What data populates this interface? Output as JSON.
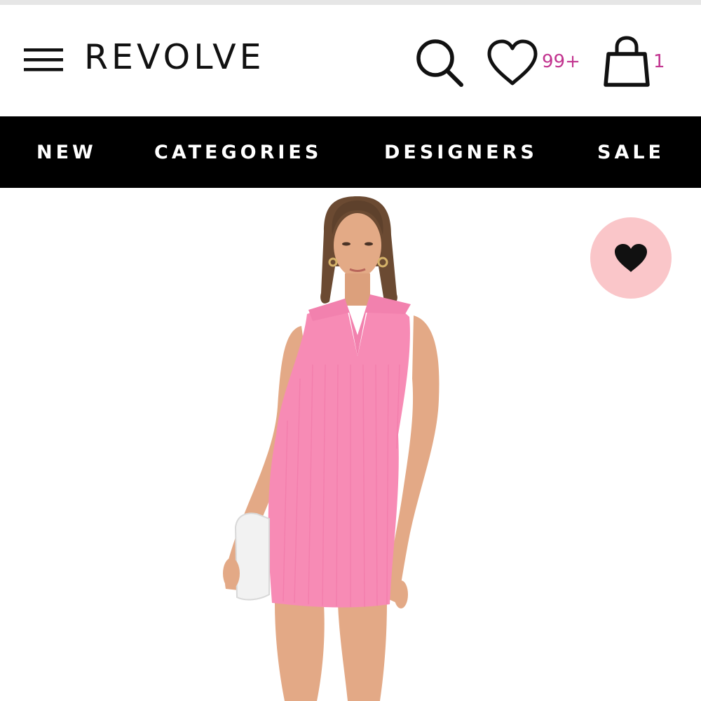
{
  "header": {
    "logo": "REVOLVE",
    "wishlist_count": "99+",
    "bag_count": "1",
    "icons": [
      "menu-icon",
      "search-icon",
      "heart-icon",
      "shopping-bag-icon"
    ]
  },
  "nav": {
    "items": [
      {
        "label": "NEW"
      },
      {
        "label": "CATEGORIES"
      },
      {
        "label": "DESIGNERS"
      },
      {
        "label": "SALE"
      }
    ]
  },
  "product": {
    "dress_color": "pink ribbed sleeveless polo mini dress",
    "favorite_icon": "heart-filled-icon"
  },
  "colors": {
    "nav_background": "#000000",
    "nav_text": "#ffffff",
    "badge": "#c2348f",
    "favorite_bg": "#fac6c9",
    "dress": "#f78bb5",
    "icon": "#111111"
  }
}
